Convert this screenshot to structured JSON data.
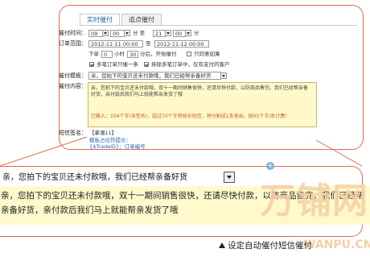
{
  "tabs": [
    "实时催付",
    "追点催付"
  ],
  "labels": {
    "period": "催付时间：",
    "order_range": "订单范围：",
    "template": "催付模板：",
    "content": "催付内容：",
    "sms_sign": "短信签名："
  },
  "time": {
    "start_hour": "09",
    "start_min": "00",
    "unit_to": "分 至",
    "end_hour": "21",
    "end_min": "00",
    "unit_end": "分"
  },
  "order_range": {
    "start": "2012-11-11 00:00",
    "sep": "至",
    "end": "2012-11-12 00:00"
  },
  "order_options": {
    "prefix": "下单",
    "hours": "0",
    "hours_unit": "小时",
    "minutes": "30",
    "minutes_unit": "分后，开始催付",
    "only_once_label": "只同意如果",
    "opt1_label": "多笔订单只催一条",
    "opt2_label": "排除多笔订单中，仅有支付的客户"
  },
  "template_value": "亲，您拍下的宝贝还未付款哦，我们已经帮亲备好货",
  "content_text": "亲，您拍下的宝贝还未付款哦，双十一期间销售很快，还请尽快付款，以防商品售完。我们已经帮亲备好货，亲付款后我们马上就能帮亲发货了哦",
  "counter_text": "已输入：104个字(含签名)，超过70个字将按长短信，将分割成1条发出，按65个字/条计费！",
  "sms_sign_value": "【拿潮11】",
  "help": {
    "title": "模板占位符提示：",
    "placeholder": "{$TradeID}：订单编号"
  },
  "zoom": {
    "template_value": "亲，您拍下的宝贝还未付款哦，我们已经帮亲备好货",
    "content_text": "亲，您拍下的宝贝还未付款哦，双十一期间销售很快，还请尽快付款，以防商品售完。我们已经帮亲备好货，亲付款后我们马上就能帮亲发货了哦"
  },
  "watermark": {
    "main": "万铺网",
    "sub": "WWW.WANPU.CN"
  },
  "footer_text": "设定自动催付短信催付",
  "colors": {
    "accent": "#e06a4a",
    "message_bg": "#fff9cc",
    "link": "#1e67b5"
  }
}
